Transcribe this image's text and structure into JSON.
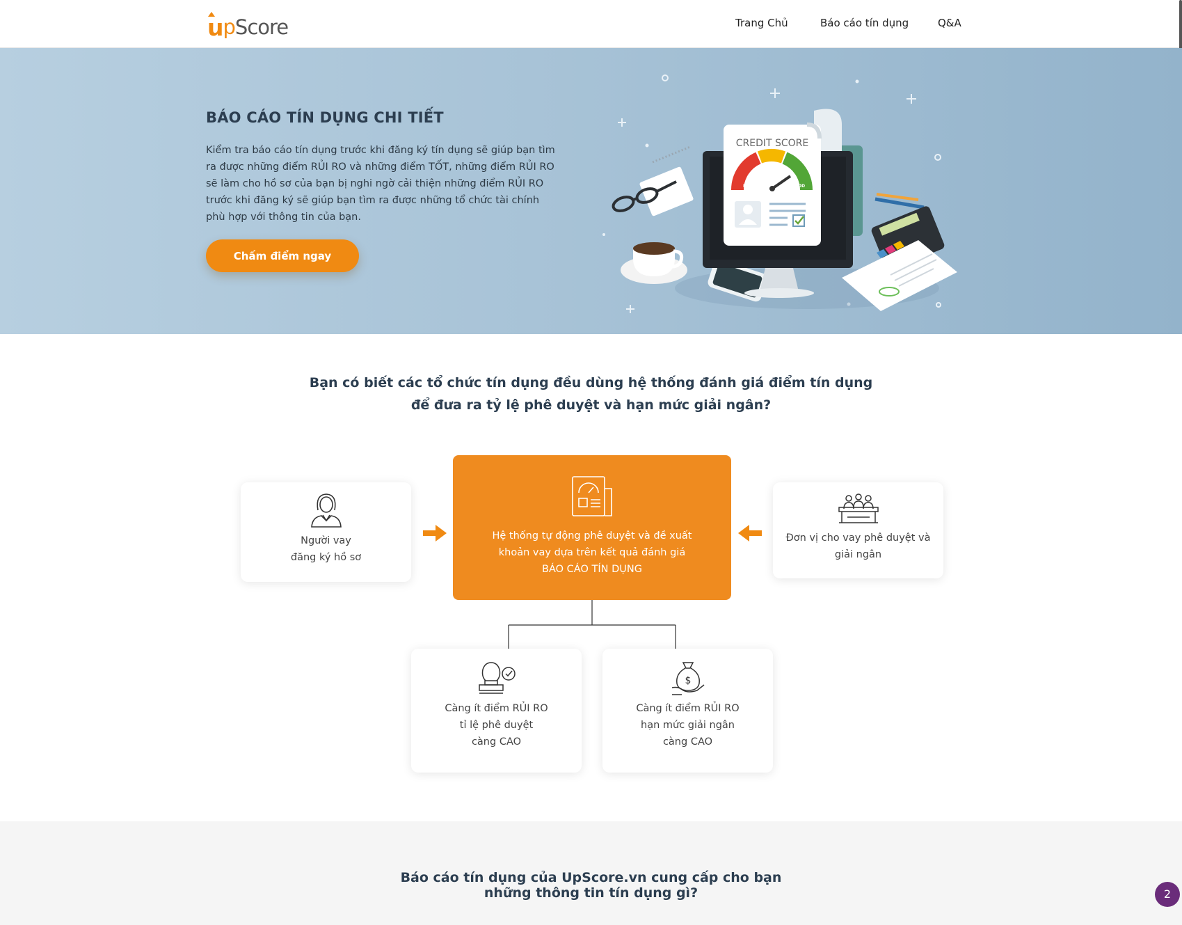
{
  "header": {
    "logo_u": "u",
    "logo_p": "p",
    "logo_score": "Score",
    "nav": [
      "Trang Chủ",
      "Báo cáo tín dụng",
      "Q&A"
    ]
  },
  "hero": {
    "title": "BÁO CÁO TÍN DỤNG CHI TIẾT",
    "text": "Kiểm tra báo cáo tín dụng trước khi đăng ký tín dụng sẽ giúp bạn tìm ra được những điểm RỦI RO và những điểm TỐT, những điểm RỦI RO sẽ làm cho hồ sơ của bạn bị nghi ngờ cải thiện những điểm RỦI RO trước khi đăng ký sẽ giúp bạn tìm ra được những tổ chức tài chính phù hợp với thông tin của bạn.",
    "button": "Chấm điểm ngay",
    "illustration": {
      "score_label": "CREDIT SCORE",
      "poor": "POOR",
      "good": "GOOD"
    }
  },
  "section1": {
    "title_line1": "Bạn có biết các tổ chức tín dụng đều dùng hệ thống đánh giá điểm tín dụng",
    "title_line2": "để đưa ra tỷ lệ phê duyệt và hạn mức giải ngân?",
    "borrower": {
      "line1": "Người vay",
      "line2": "đăng ký hồ sơ"
    },
    "system": {
      "line1": "Hệ thống tự động phê duyệt và đề xuất",
      "line2": "khoản vay dựa trên kết quả đánh giá",
      "line3": "BÁO CÁO TÍN DỤNG"
    },
    "lender": {
      "line1": "Đơn vị cho vay phê duyệt và",
      "line2": "giải ngân"
    },
    "approval": {
      "line1": "Càng ít điểm RỦI RO",
      "line2": "tỉ lệ phê duyệt",
      "line3": "càng CAO"
    },
    "limit": {
      "line1": "Càng ít điểm RỦI RO",
      "line2": "hạn mức giải ngân",
      "line3": "càng CAO"
    },
    "colors": {
      "accent": "#f08a12",
      "box": "#ef8b1f"
    }
  },
  "section2": {
    "title_line1": "Báo cáo tín dụng của UpScore.vn cung cấp cho bạn",
    "title_line2": "những thông tin tín dụng gì?"
  },
  "chat_badge": "2"
}
